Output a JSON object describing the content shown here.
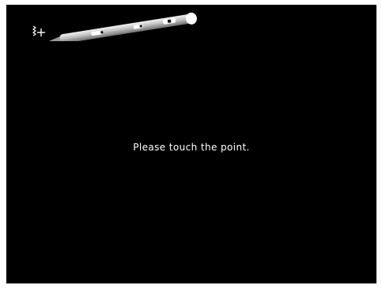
{
  "calibration": {
    "instruction": "Please touch the point."
  },
  "colors": {
    "background": "#000000",
    "text": "#ffffff",
    "pen_body": "#b9b9b9"
  },
  "icons": {
    "touch_target": "crosshair-target-icon",
    "stylus": "stylus-pen-icon"
  }
}
